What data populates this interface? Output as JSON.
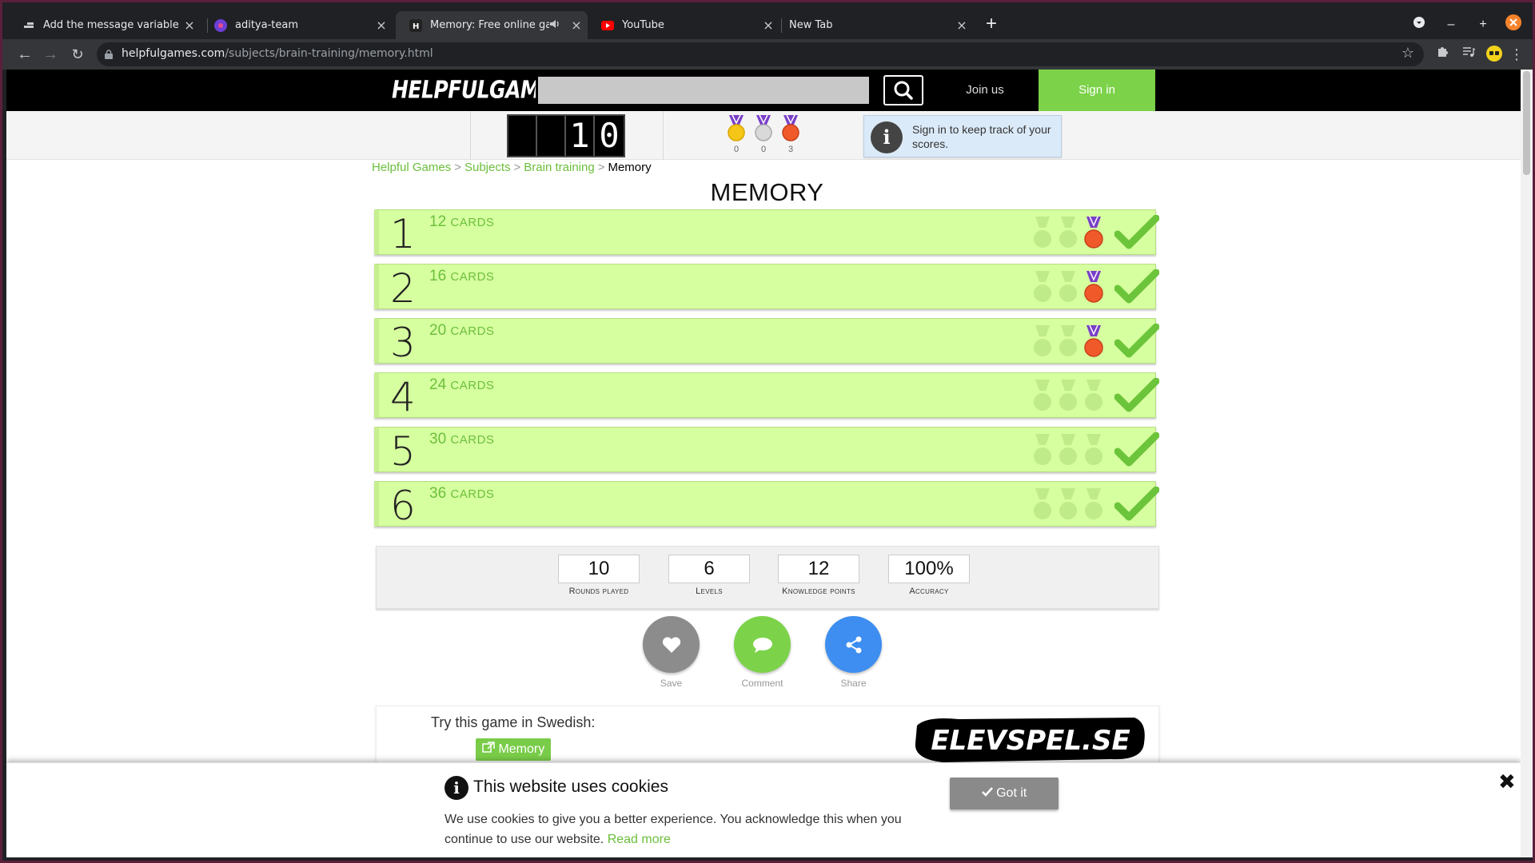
{
  "browser": {
    "tabs": [
      {
        "title": "Add the message variable - St",
        "active": false
      },
      {
        "title": "aditya-team",
        "active": false
      },
      {
        "title": "Memory: Free online game",
        "active": true,
        "audio": true
      },
      {
        "title": "YouTube",
        "active": false
      },
      {
        "title": "New Tab",
        "active": false
      }
    ],
    "url_host": "helpfulgames.com",
    "url_path": "/subjects/brain-training/memory.html"
  },
  "site": {
    "logo": "HELPFULGAMES",
    "join_label": "Join us",
    "signin_label": "Sign in",
    "score_digits": [
      "",
      "",
      "1",
      "0"
    ],
    "medal_counts": [
      "0",
      "0",
      "3"
    ],
    "info_text": "Sign in to keep track of your scores."
  },
  "breadcrumb": {
    "items": [
      "Helpful Games",
      "Subjects",
      "Brain training"
    ],
    "separator": ">",
    "current": "Memory"
  },
  "page_title": "MEMORY",
  "levels": [
    {
      "number": "1",
      "count": "12",
      "unit": "CARDS",
      "bronze_earned": true
    },
    {
      "number": "2",
      "count": "16",
      "unit": "CARDS",
      "bronze_earned": true
    },
    {
      "number": "3",
      "count": "20",
      "unit": "CARDS",
      "bronze_earned": true
    },
    {
      "number": "4",
      "count": "24",
      "unit": "CARDS",
      "bronze_earned": false
    },
    {
      "number": "5",
      "count": "30",
      "unit": "CARDS",
      "bronze_earned": false
    },
    {
      "number": "6",
      "count": "36",
      "unit": "CARDS",
      "bronze_earned": false
    }
  ],
  "stats": [
    {
      "value": "10",
      "label": "Rounds played"
    },
    {
      "value": "6",
      "label": "Levels"
    },
    {
      "value": "12",
      "label": "Knowledge points"
    },
    {
      "value": "100%",
      "label": "Accuracy"
    }
  ],
  "actions": {
    "save_label": "Save",
    "comment_label": "Comment",
    "share_label": "Share"
  },
  "swedish": {
    "try_text": "Try this game in Swedish:",
    "button_label": "Memory",
    "partner_logo": "ELEVSPEL.SE"
  },
  "cookie": {
    "title": "This website uses cookies",
    "text": "We use cookies to give you a better experience. You acknowledge this when you continue to use our website.",
    "read_more": "Read more",
    "got_it": "Got it",
    "close_glyph": "✖"
  },
  "colors": {
    "accent_green": "#7cd34a",
    "level_bg": "#d6ff9f",
    "check_green": "#6cc43a"
  }
}
